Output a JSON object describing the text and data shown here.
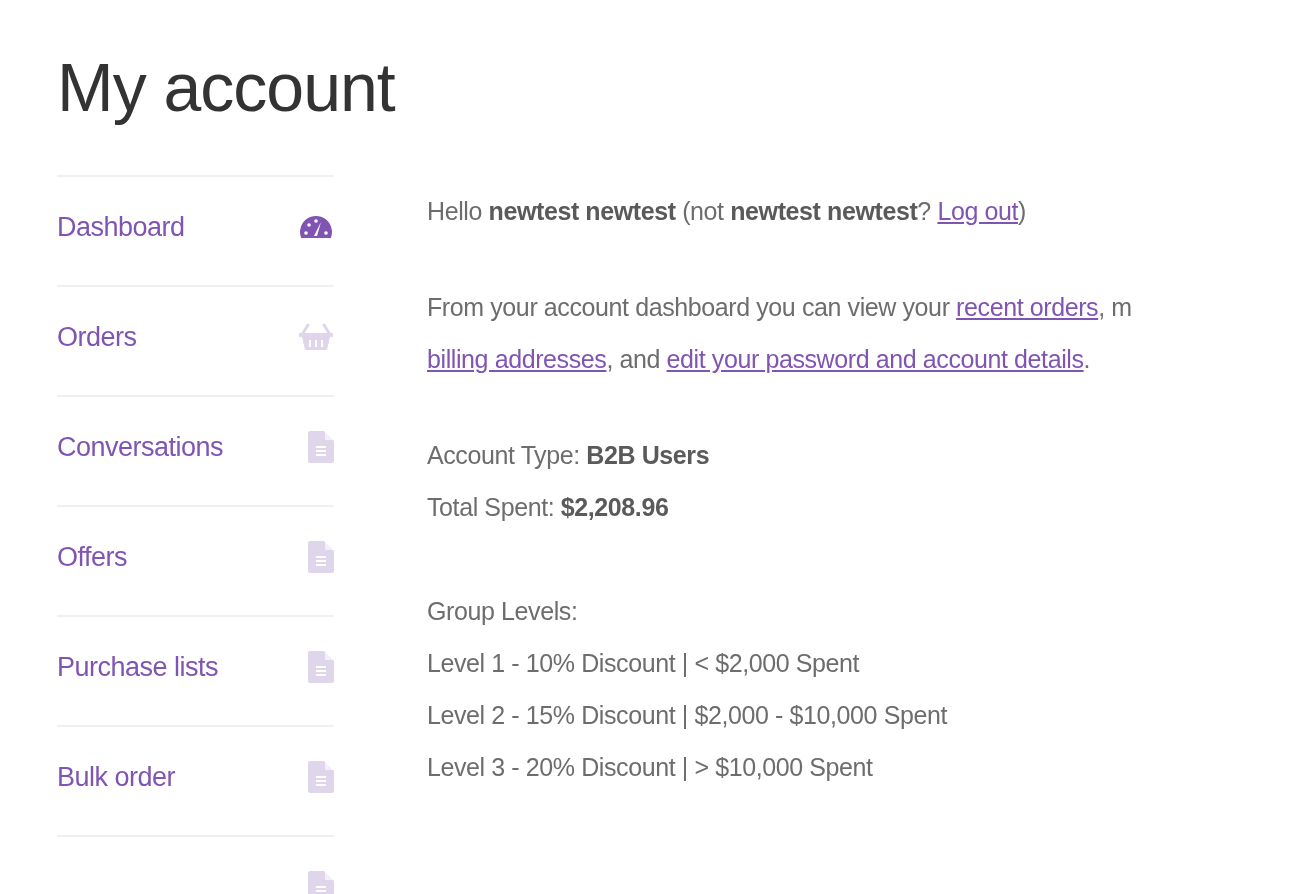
{
  "title": "My account",
  "nav": [
    {
      "label": "Dashboard",
      "kind": "gauge",
      "selected": true
    },
    {
      "label": "Orders",
      "kind": "basket",
      "selected": false
    },
    {
      "label": "Conversations",
      "kind": "document",
      "selected": false
    },
    {
      "label": "Offers",
      "kind": "document",
      "selected": false
    },
    {
      "label": "Purchase lists",
      "kind": "document",
      "selected": false
    },
    {
      "label": "Bulk order",
      "kind": "document",
      "selected": false
    },
    {
      "kind": "document",
      "selected": false
    }
  ],
  "greeting": "Hello **newtest newtest** (not **newtest newtest**? ",
  "logout_link": "Log out",
  "greeting_end": ")",
  "intro_lines": [
    [
      {
        "kind": "text",
        "text": "From your account dashboard you can view your "
      },
      {
        "kind": "link",
        "text": "recent orders"
      },
      {
        "kind": "text",
        "text": ", m"
      }
    ],
    [
      {
        "kind": "link",
        "text": "billing addresses"
      },
      {
        "kind": "text",
        "text": ", and "
      },
      {
        "kind": "link",
        "text": "edit your password and account details"
      },
      {
        "kind": "text",
        "text": "."
      }
    ]
  ],
  "account_lines": [
    "Account Type: **B2B Users**",
    "Total Spent: **$2,208.96**"
  ],
  "levels_heading": "Group Levels:",
  "levels": [
    "Level 1 - 10% Discount | < $2,000 Spent",
    "Level 2 - 15% Discount | $2,000 - $10,000 Spent",
    "Level 3 - 20% Discount | > $10,000 Spent"
  ]
}
